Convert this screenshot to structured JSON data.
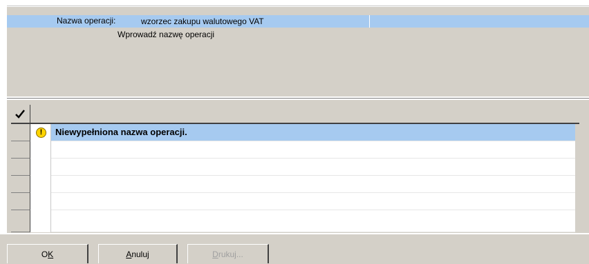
{
  "form": {
    "name_label": "Nazwa operacji:",
    "name_value": "wzorzec zakupu walutowego VAT",
    "hint": "Wprowadź nazwę operacji"
  },
  "messages": {
    "header_icon": "checkmark-icon",
    "rows": [
      {
        "icon": "warning-icon",
        "icon_glyph": "!",
        "text": "Niewypełniona nazwa operacji."
      },
      {
        "text": ""
      },
      {
        "text": ""
      },
      {
        "text": ""
      },
      {
        "text": ""
      },
      {
        "text": ""
      }
    ]
  },
  "buttons": {
    "ok": {
      "label": "OK",
      "mnemonic": "K"
    },
    "cancel": {
      "label": "Anuluj",
      "mnemonic": "A"
    },
    "print": {
      "label": "Drukuj...",
      "mnemonic": "D",
      "disabled": true
    }
  },
  "colors": {
    "selection": "#a6caf0",
    "panel": "#d4d0c8",
    "warning": "#ffd400"
  }
}
